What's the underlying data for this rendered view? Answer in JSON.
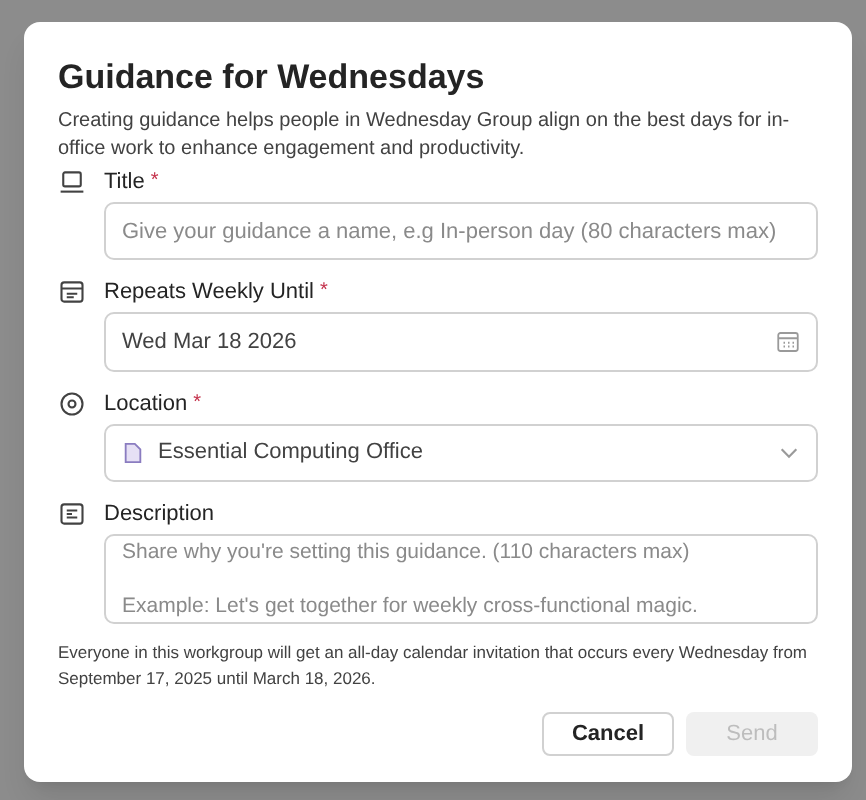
{
  "dialog": {
    "title": "Guidance for Wednesdays",
    "intro": "Creating guidance helps people in Wednesday Group align on the best days for in-office work to enhance engagement and productivity.",
    "fields": [
      {
        "kind": "text",
        "label": "Title",
        "required_mark": "*",
        "placeholder": "Give your guidance a name, e.g In-person day (80 characters max)"
      },
      {
        "kind": "date",
        "label": "Repeats Weekly Until",
        "required_mark": "*",
        "value": "Wed Mar 18 2026"
      },
      {
        "kind": "select",
        "label": "Location",
        "required_mark": "*",
        "value": "Essential Computing Office"
      },
      {
        "kind": "textarea",
        "label": "Description",
        "placeholder": "Share why you're setting this guidance. (110 characters max)\n\nExample: Let's get together for weekly cross-functional magic."
      }
    ],
    "notice": "Everyone in this workgroup will get an all-day calendar invitation that occurs every Wednesday from September 17, 2025 until March 18, 2026.",
    "buttons": [
      {
        "label": "Cancel",
        "disabled": false
      },
      {
        "label": "Send",
        "disabled": true
      }
    ]
  }
}
